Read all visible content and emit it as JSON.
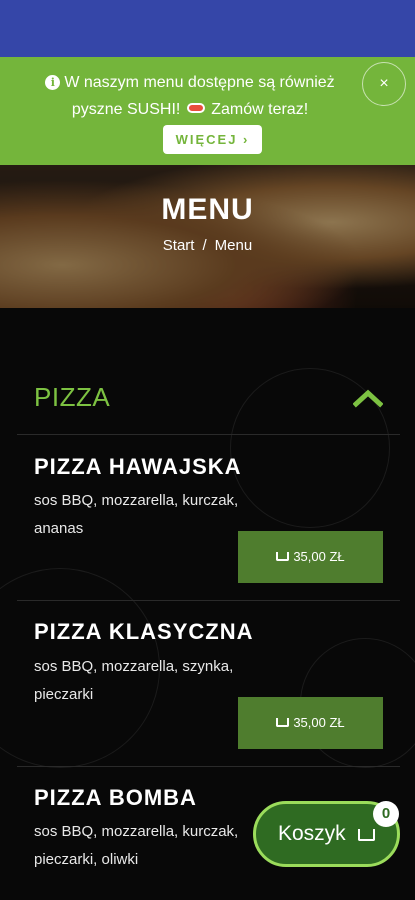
{
  "promo": {
    "text_part1": "W naszym menu dostępne są również pyszne SUSHI!",
    "text_part2": "Zamów teraz!",
    "more_label": "WIĘCEJ ›",
    "close_label": "×"
  },
  "hero": {
    "title": "MENU",
    "breadcrumb": [
      "Start",
      "/",
      "Menu"
    ]
  },
  "category": {
    "title": "PIZZA"
  },
  "items": [
    {
      "name": "PIZZA  HAWAJSKA",
      "desc": "sos BBQ, mozzarella, kurczak, ananas",
      "price": "35,00 ZŁ"
    },
    {
      "name": "PIZZA  KLASYCZNA",
      "desc": "sos BBQ, mozzarella, szynka, pieczarki",
      "price": "35,00 ZŁ"
    },
    {
      "name": "PIZZA  BOMBA",
      "desc": "sos BBQ, mozzarella, kurczak, pieczarki, oliwki"
    }
  ],
  "cart": {
    "label": "Koszyk",
    "count": "0"
  },
  "colors": {
    "accent_green": "#74b53b",
    "dark_green": "#4f7d2e",
    "status_blue": "#3546a8"
  }
}
